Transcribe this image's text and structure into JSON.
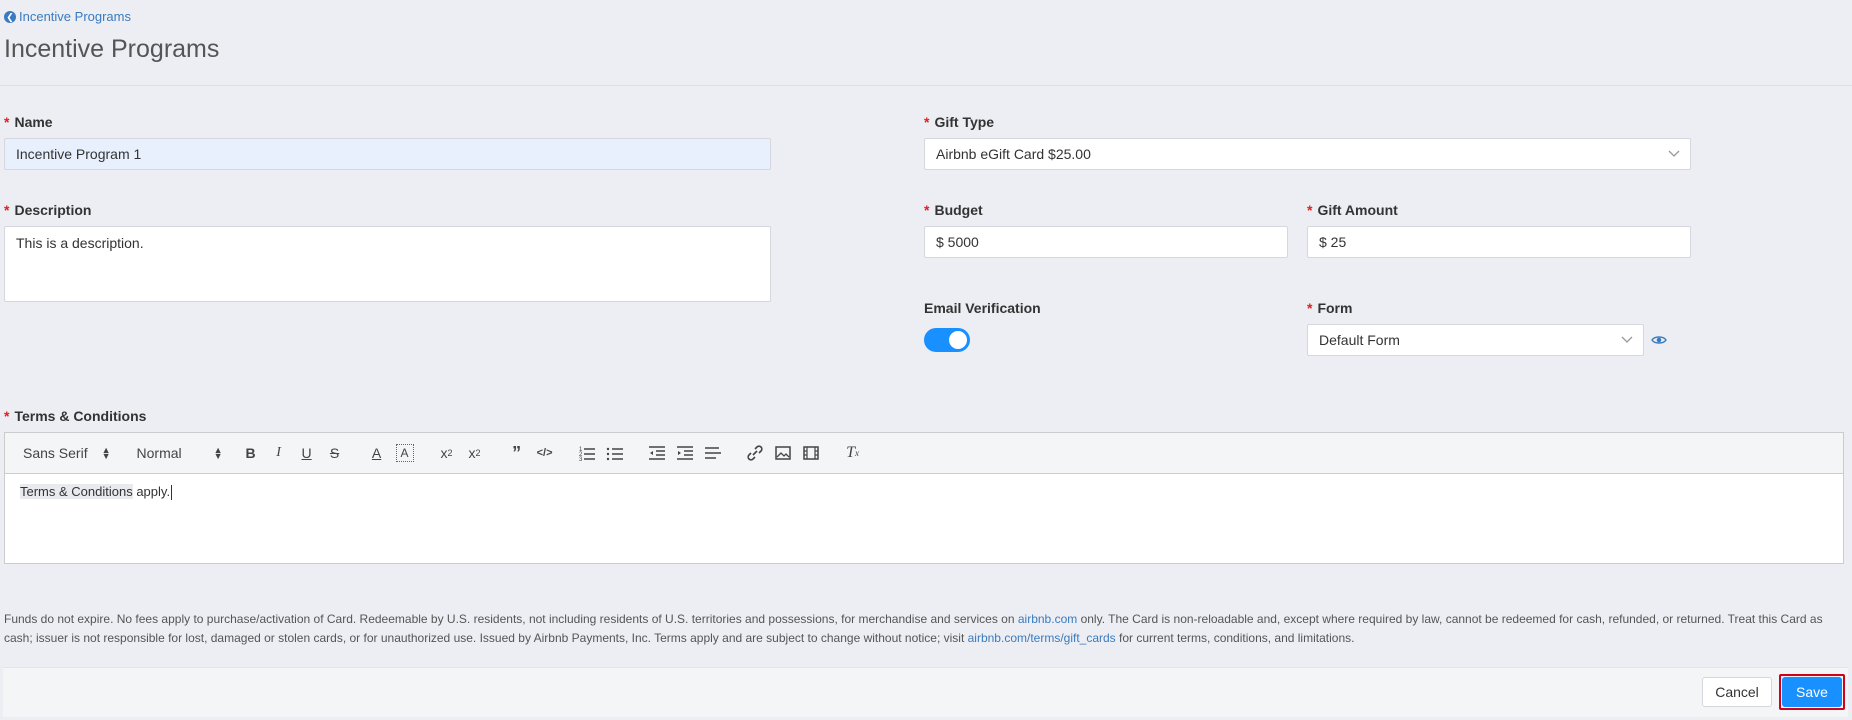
{
  "breadcrumb": {
    "back_label": "Incentive Programs"
  },
  "page": {
    "title": "Incentive Programs"
  },
  "form": {
    "name": {
      "label": "Name",
      "value": "Incentive Program 1"
    },
    "description": {
      "label": "Description",
      "value": "This is a description."
    },
    "gift_type": {
      "label": "Gift Type",
      "value": "Airbnb eGift Card $25.00"
    },
    "budget": {
      "label": "Budget",
      "value": "$ 5000"
    },
    "gift_amount": {
      "label": "Gift Amount",
      "value": "$ 25"
    },
    "email_verification": {
      "label": "Email Verification",
      "enabled": true
    },
    "form_select": {
      "label": "Form",
      "value": "Default Form"
    },
    "terms": {
      "label": "Terms & Conditions",
      "toolbar": {
        "font": "Sans Serif",
        "size": "Normal"
      },
      "content_highlight": "Terms & Conditions",
      "content_rest": " apply."
    }
  },
  "fineprint": {
    "part1": "Funds do not expire. No fees apply to purchase/activation of Card. Redeemable by U.S. residents, not including residents of U.S. territories and possessions, for merchandise and services on ",
    "link1": "airbnb.com",
    "part2": " only. The Card is non-reloadable and, except where required by law, cannot be redeemed for cash, refunded, or returned. Treat this Card as cash; issuer is not responsible for lost, damaged or stolen cards, or for unauthorized use. Issued by Airbnb Payments, Inc. Terms apply and are subject to change without notice; visit ",
    "link2": "airbnb.com/terms/gift_cards",
    "part3": " for current terms, conditions, and limitations."
  },
  "footer": {
    "cancel_label": "Cancel",
    "save_label": "Save"
  },
  "colors": {
    "accent": "#1890ff",
    "required": "#e02020",
    "link": "#3a7bbf",
    "save_outline": "#d0021b"
  },
  "icons": [
    "arrow-left-circle-icon",
    "chevron-down-icon",
    "eye-icon",
    "bold-icon",
    "italic-icon",
    "underline-icon",
    "strikethrough-icon",
    "text-color-icon",
    "background-color-icon",
    "subscript-icon",
    "superscript-icon",
    "blockquote-icon",
    "code-icon",
    "ordered-list-icon",
    "bullet-list-icon",
    "outdent-icon",
    "indent-icon",
    "align-icon",
    "link-icon",
    "image-icon",
    "video-icon",
    "clear-format-icon"
  ]
}
